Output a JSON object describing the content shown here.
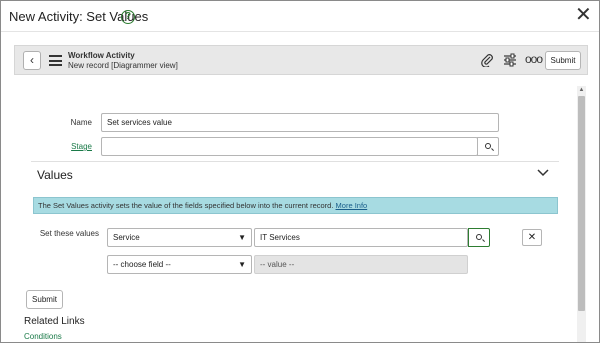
{
  "modal": {
    "title": "New Activity: Set Values",
    "help_icon": "?",
    "close_icon": "✕"
  },
  "record_header": {
    "back_icon": "‹",
    "title": "Workflow Activity",
    "subtitle": "New record [Diagrammer view]",
    "attach_icon": "paperclip-icon",
    "more_icon": "ooo",
    "submit_label": "Submit"
  },
  "form": {
    "name_label": "Name",
    "name_value": "Set services value",
    "stage_label": "Stage",
    "stage_value": ""
  },
  "section": {
    "title": "Values",
    "chevron": "⌄",
    "info_text": "The Set Values activity sets the value of the fields specified below into the current record.",
    "info_link": "More Info"
  },
  "values": {
    "label": "Set these values",
    "rows": [
      {
        "field": "Service",
        "value": "IT Services"
      },
      {
        "field": "-- choose field --",
        "value": "-- value --"
      }
    ],
    "caret": "▼",
    "remove_icon": "✕"
  },
  "footer": {
    "submit_label": "Submit",
    "related_title": "Related Links",
    "conditions_link": "Conditions"
  }
}
